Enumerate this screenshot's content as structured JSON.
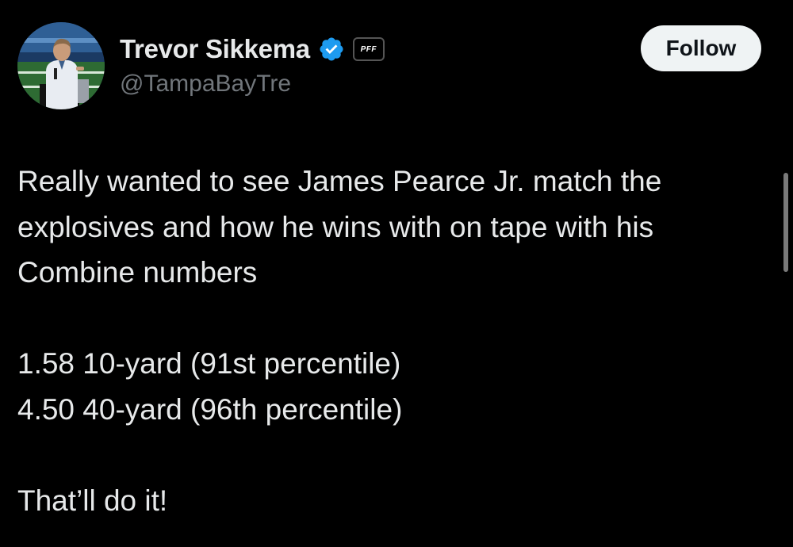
{
  "author": {
    "display_name": "Trevor Sikkema",
    "handle": "@TampaBayTre",
    "affiliate_badge": "PFF",
    "verified": true
  },
  "follow_button": {
    "label": "Follow"
  },
  "tweet": {
    "line1": "Really wanted to see James Pearce Jr. match the",
    "line2": "explosives and how he wins with on tape with his",
    "line3": "Combine numbers",
    "stat1": "1.58 10-yard (91st percentile)",
    "stat2": "4.50 40-yard (96th percentile)",
    "closing": "That’ll do it!"
  },
  "colors": {
    "background": "#000000",
    "text_primary": "#e7e9ea",
    "text_secondary": "#71767b",
    "verified_blue": "#1d9bf0",
    "follow_bg": "#eff3f4"
  }
}
